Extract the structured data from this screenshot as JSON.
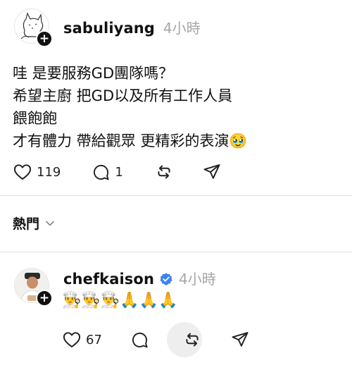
{
  "post1": {
    "username": "sabuliyang",
    "time": "4小時",
    "lines": [
      "哇 是要服務GD團隊嗎？",
      "希望主廚 把GD以及所有工作人員",
      "餵飽飽",
      "才有體力 帶給觀眾 更精彩的表演🥹"
    ],
    "likes": "119",
    "replies": "1",
    "icons": [
      "heart-icon",
      "comment-icon",
      "repost-icon",
      "share-icon"
    ]
  },
  "sort": {
    "label": "熱門"
  },
  "post2": {
    "username": "chefkaison",
    "time": "4小時",
    "verified_color": "#3b82f6",
    "emojis": "👨‍🍳👨‍🍳👨‍🍳🙏🙏🙏",
    "likes": "67",
    "icons": [
      "heart-icon",
      "comment-icon",
      "repost-icon",
      "share-icon"
    ]
  }
}
